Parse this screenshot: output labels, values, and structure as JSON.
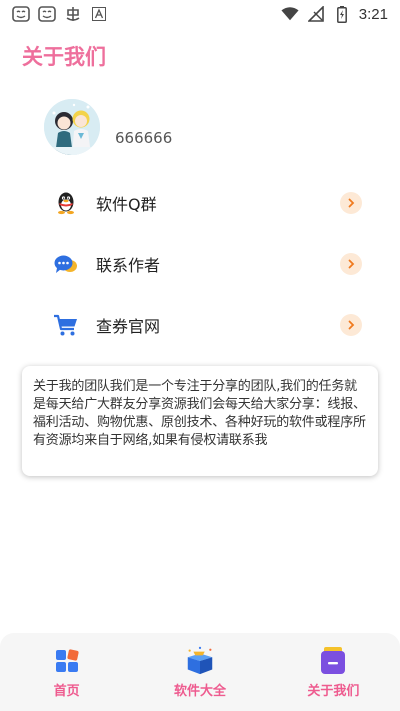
{
  "status_bar": {
    "time": "3:21",
    "left_icons": [
      "smiley-face-icon",
      "smiley-face-icon",
      "notification-app-icon",
      "font-a-icon"
    ],
    "right_icons": [
      "wifi-icon",
      "signal-off-icon",
      "battery-charging-icon"
    ]
  },
  "header": {
    "title": "关于我们",
    "title_color": "#ee6f9c"
  },
  "profile": {
    "username": "666666"
  },
  "menu": {
    "items": [
      {
        "label": "软件Q群",
        "icon": "qq-penguin-icon"
      },
      {
        "label": "联系作者",
        "icon": "chat-bubble-icon"
      },
      {
        "label": "查券官网",
        "icon": "shopping-cart-icon"
      }
    ]
  },
  "about": {
    "text": "关于我的团队我们是一个专注于分享的团队,我们的任务就是每天给广大群友分享资源我们会每天给大家分享：线报、福利活动、购物优惠、原创技术、各种好玩的软件或程序所有资源均来自于网络,如果有侵权请联系我"
  },
  "bottom_nav": {
    "tabs": [
      {
        "label": "首页",
        "icon": "home-grid-icon"
      },
      {
        "label": "软件大全",
        "icon": "gift-box-icon"
      },
      {
        "label": "关于我们",
        "icon": "about-card-icon"
      }
    ],
    "label_color": "#ee5b8f"
  }
}
